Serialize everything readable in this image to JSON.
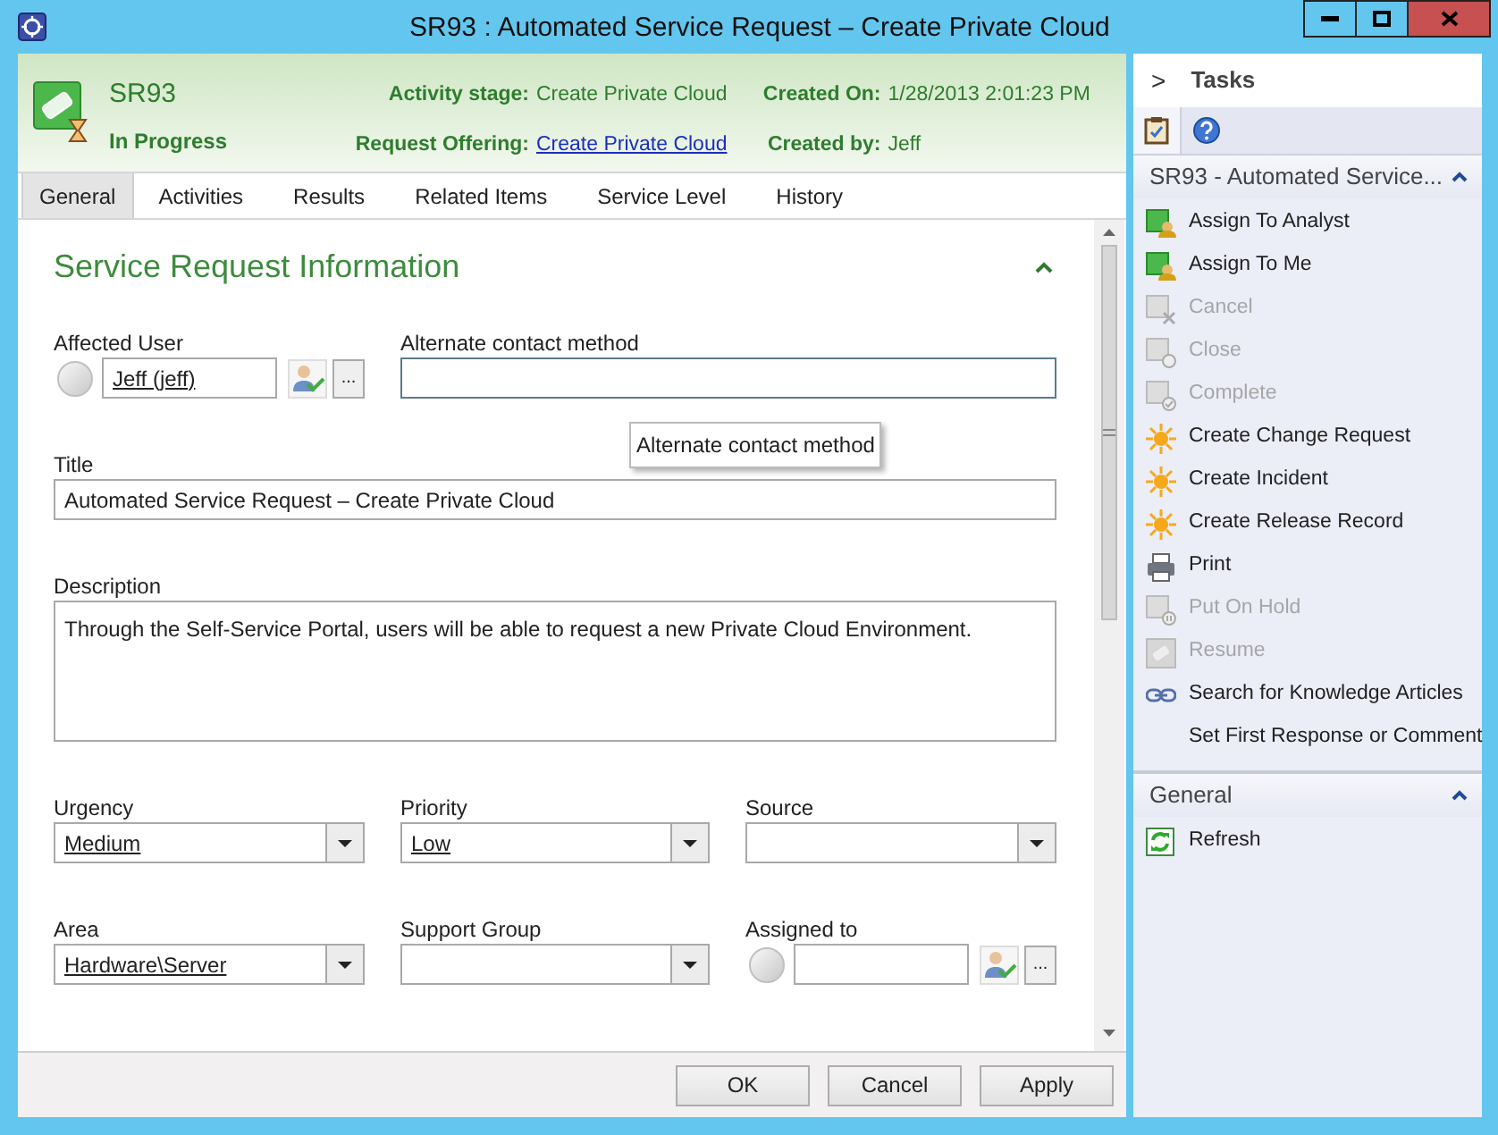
{
  "window": {
    "title": "SR93 : Automated Service Request – Create Private Cloud"
  },
  "header": {
    "id": "SR93",
    "status": "In Progress",
    "details": [
      {
        "label": "Activity stage:",
        "value": "Create Private Cloud",
        "link": false
      },
      {
        "label": "Created On:",
        "value": "1/28/2013 2:01:23 PM",
        "link": false
      },
      {
        "label": "Request Offering:",
        "value": "Create Private Cloud",
        "link": true
      },
      {
        "label": "Created by:",
        "value": "Jeff",
        "link": false
      }
    ]
  },
  "tabs": [
    {
      "label": "General",
      "selected": true
    },
    {
      "label": "Activities",
      "selected": false
    },
    {
      "label": "Results",
      "selected": false
    },
    {
      "label": "Related Items",
      "selected": false
    },
    {
      "label": "Service Level",
      "selected": false
    },
    {
      "label": "History",
      "selected": false
    }
  ],
  "section": {
    "title": "Service Request Information",
    "expanded": true
  },
  "rows": [
    [
      {
        "kind": "user_picker",
        "label": "Affected User",
        "value": "Jeff (jeff)",
        "ellipsis": "..."
      },
      {
        "kind": "text",
        "label": "Alternate contact method",
        "focused": true,
        "tooltip": "Alternate contact method"
      }
    ],
    [
      {
        "kind": "text",
        "label": "Title",
        "value": "Automated Service Request – Create Private Cloud",
        "focused": false
      }
    ],
    [
      {
        "kind": "textarea",
        "label": "Description",
        "value": "Through the Self-Service Portal, users will be able to request a new Private Cloud Environment."
      }
    ],
    [
      {
        "kind": "dropdown",
        "label": "Urgency",
        "value": "Medium"
      },
      {
        "kind": "dropdown",
        "label": "Priority",
        "value": "Low"
      },
      {
        "kind": "dropdown",
        "label": "Source"
      }
    ],
    [
      {
        "kind": "dropdown",
        "label": "Area",
        "value": "Hardware\\Server"
      },
      {
        "kind": "dropdown",
        "label": "Support Group"
      },
      {
        "kind": "user_picker",
        "label": "Assigned to",
        "ellipsis": "..."
      }
    ]
  ],
  "buttons": [
    "OK",
    "Cancel",
    "Apply"
  ],
  "tasks": {
    "title": "Tasks",
    "chevron": ">",
    "pane_tabs": [
      {
        "kind": "tasks",
        "selected": true
      },
      {
        "kind": "help",
        "selected": false
      }
    ],
    "sections": [
      {
        "title": "SR93 - Automated Service...",
        "expanded": true,
        "items": [
          {
            "label": "Assign To Analyst",
            "kind": "assign",
            "disabled": false
          },
          {
            "label": "Assign To Me",
            "kind": "assign",
            "disabled": false
          },
          {
            "label": "Cancel",
            "kind": "cancel",
            "disabled": true
          },
          {
            "label": "Close",
            "kind": "close",
            "disabled": true
          },
          {
            "label": "Complete",
            "kind": "complete",
            "disabled": true
          },
          {
            "label": "Create Change Request",
            "kind": "create",
            "disabled": false
          },
          {
            "label": "Create Incident",
            "kind": "create",
            "disabled": false
          },
          {
            "label": "Create Release Record",
            "kind": "create",
            "disabled": false
          },
          {
            "label": "Print",
            "kind": "print",
            "disabled": false
          },
          {
            "label": "Put On Hold",
            "kind": "hold",
            "disabled": true
          },
          {
            "label": "Resume",
            "kind": "resume",
            "disabled": true
          },
          {
            "label": "Search for Knowledge Articles",
            "kind": "search",
            "disabled": false
          },
          {
            "label": "Set First Response or Comment",
            "kind": "comment",
            "disabled": false
          }
        ]
      },
      {
        "title": "General",
        "expanded": true,
        "items": [
          {
            "label": "Refresh",
            "kind": "refresh",
            "disabled": false
          }
        ]
      }
    ]
  }
}
